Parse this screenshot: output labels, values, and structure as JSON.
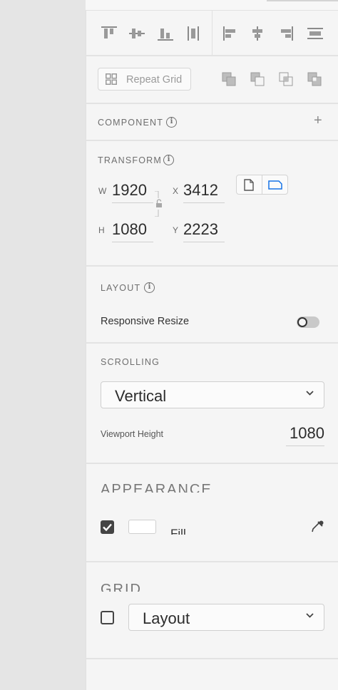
{
  "align_toolbar": {
    "icons": [
      "align-top-icon",
      "align-middle-icon",
      "align-bottom-icon",
      "distribute-vertical-icon",
      "align-left-icon",
      "align-center-icon",
      "align-right-icon",
      "distribute-horizontal-icon"
    ]
  },
  "repeat_grid": {
    "label": "Repeat Grid"
  },
  "component": {
    "title": "COMPONENT",
    "info": "i",
    "add": "+"
  },
  "transform": {
    "title": "TRANSFORM",
    "info": "i",
    "w_label": "W",
    "w_value": "1920",
    "h_label": "H",
    "h_value": "1080",
    "x_label": "X",
    "x_value": "3412",
    "y_label": "Y",
    "y_value": "2223"
  },
  "layout": {
    "title": "LAYOUT",
    "info": "i",
    "responsive_label": "Responsive Resize",
    "responsive_on": false
  },
  "scrolling": {
    "title": "SCROLLING",
    "mode": "Vertical",
    "viewport_label": "Viewport Height",
    "viewport_value": "1080"
  },
  "appearance": {
    "title": "APPEARANCE",
    "fill_label": "Fill",
    "fill_checked": true,
    "fill_color": "#ffffff"
  },
  "grid": {
    "title": "GRID",
    "checked": false,
    "mode": "Layout"
  },
  "colors": {
    "accent": "#1473e6",
    "panel_bg": "#f5f5f5",
    "canvas_bg": "#e5e5e5"
  }
}
